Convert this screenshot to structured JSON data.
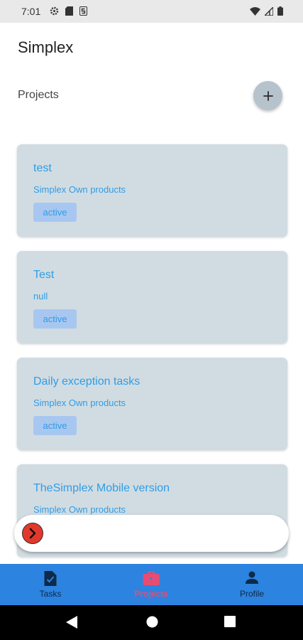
{
  "status": {
    "time": "7:01"
  },
  "app": {
    "title": "Simplex"
  },
  "section": {
    "title": "Projects"
  },
  "projects": [
    {
      "title": "test",
      "subtitle": "Simplex Own products",
      "status": "active"
    },
    {
      "title": "Test",
      "subtitle": "null",
      "status": "active"
    },
    {
      "title": "Daily exception tasks",
      "subtitle": "Simplex Own products",
      "status": "active"
    },
    {
      "title": "TheSimplex Mobile version",
      "subtitle": "Simplex Own products"
    }
  ],
  "nav": {
    "items": [
      {
        "label": "Tasks",
        "icon": "task-document-icon"
      },
      {
        "label": "Projects",
        "icon": "briefcase-icon",
        "active": true
      },
      {
        "label": "Profile",
        "icon": "person-icon"
      }
    ]
  },
  "colors": {
    "accent": "#2f9de6",
    "card": "#d1dce2",
    "nav_bg": "#2c83e0",
    "nav_active": "#e74c72",
    "go_button": "#e2382c"
  }
}
